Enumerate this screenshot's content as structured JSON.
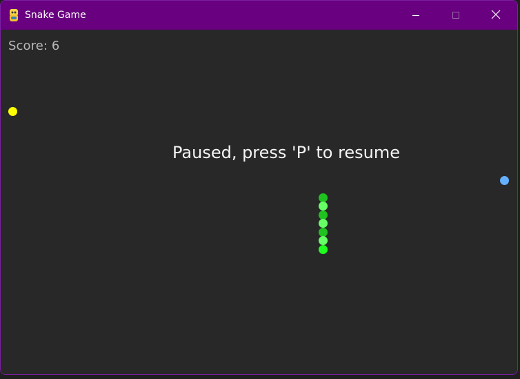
{
  "window": {
    "title": "Snake Game",
    "titlebar_color": "#68007f",
    "icons": {
      "app": "python-icon",
      "minimize": "minimize-icon",
      "maximize": "maximize-icon",
      "close": "close-icon"
    }
  },
  "game": {
    "score_text": "Score: 6",
    "paused_text": "Paused, press 'P' to resume",
    "background_color": "#282828",
    "food_items": [
      {
        "name": "food-yellow",
        "color": "#ffff00"
      },
      {
        "name": "food-blue",
        "color": "#64b0ff"
      }
    ],
    "snake": {
      "segment_colors": [
        "#1fc21f",
        "#66ff66",
        "#1fc21f",
        "#66ff66",
        "#1fc21f",
        "#66ff66",
        "#1fff1f"
      ]
    }
  }
}
